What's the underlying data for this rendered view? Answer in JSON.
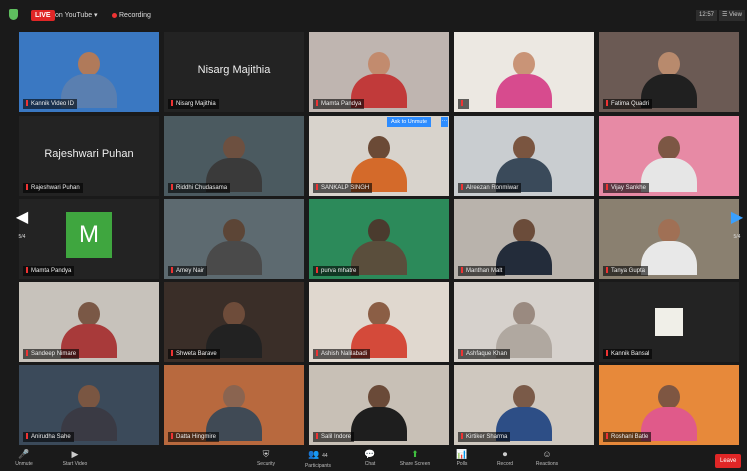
{
  "topbar": {
    "live_label": "LIVE",
    "youtube_label": "on YouTube ▾",
    "recording_label": "Recording",
    "clock": "12:57",
    "view_label": "☰ View"
  },
  "pager": {
    "left_label": "5/4",
    "right_label": "5/4"
  },
  "colors": {
    "active_speaker_border": "#d9d240",
    "live_red": "#e02626",
    "avatar_green": "#3fa63f",
    "ask_blue": "#2d8cff"
  },
  "tiles": [
    {
      "name": "Kannik Video ID",
      "head": "#b07a5a",
      "body": "#5a7fb0",
      "bg": "#3a78c2"
    },
    {
      "name": "Nisarg Majithia"
    },
    {
      "name": "Mamta Pandya",
      "head": "#c28b6e",
      "body": "#c13a3a",
      "bg": "#bfb5b0"
    },
    {
      "name": "",
      "head": "#c99477",
      "body": "#d74b8e",
      "bg": "#ece8e2"
    },
    {
      "name": "Fatima Quadri",
      "head": "#b88a6d",
      "body": "#202020",
      "bg": "#6b5a54"
    },
    {
      "name": "Rajeshwari Puhan"
    },
    {
      "name": "Riddhi Chudasama",
      "head": "#6d5040",
      "body": "#3a3a3a",
      "bg": "#4b5a60"
    },
    {
      "name": "SANKALP SINGH",
      "head": "#6b4a36",
      "body": "#d46a2a",
      "bg": "#d8d3cc"
    },
    {
      "name": "Alreezan Ronmiwar",
      "head": "#7a5540",
      "body": "#3a4a5a",
      "bg": "#c9cdd0"
    },
    {
      "name": "Vijay Sankhe",
      "head": "#7c5744",
      "body": "#e6e6e6",
      "bg": "#e78aa5"
    },
    {
      "name": "Mamta Pandya"
    },
    {
      "name": "Amey Nair",
      "head": "#5c4536",
      "body": "#4a4a4a",
      "bg": "#5d6a70"
    },
    {
      "name": "purva mhatre",
      "head": "#4a3b2e",
      "body": "#5a4e3c",
      "bg": "#2c8a5a"
    },
    {
      "name": "Manthan Malt",
      "head": "#6b4c3a",
      "body": "#232c3a",
      "bg": "#b9b3ac"
    },
    {
      "name": "Tanya Gupta",
      "head": "#a07055",
      "body": "#e8e8e8",
      "bg": "#8a8070"
    },
    {
      "name": "Sandeep Nimare",
      "head": "#7a5846",
      "body": "#a83a3a",
      "bg": "#c7c2bb"
    },
    {
      "name": "Shweta Barave",
      "head": "#6e4c3a",
      "body": "#222222",
      "bg": "#3a2e28"
    },
    {
      "name": "Ashish Nalilabadi",
      "head": "#8b5e45",
      "body": "#d44a3a",
      "bg": "#e0d8cf"
    },
    {
      "name": "Ashfaque Khan",
      "head": "#9a8a80",
      "body": "#b0a8a0",
      "bg": "#d6d1cc"
    },
    {
      "name": "Kannik Bansal"
    },
    {
      "name": "Anirudha Sahe",
      "head": "#7a5642",
      "body": "#3a3a44",
      "bg": "#3b4a5a"
    },
    {
      "name": "Datta Hingmire",
      "head": "#8a6450",
      "body": "#404a55",
      "bg": "#b8693e"
    },
    {
      "name": "Salil Indore",
      "head": "#6a4a38",
      "body": "#1e1e1e",
      "bg": "#c8c0b6"
    },
    {
      "name": "Kirtiker Sharma",
      "head": "#7a5a48",
      "body": "#2d4e86",
      "bg": "#cfc8bf"
    },
    {
      "name": "Roshani Batle",
      "head": "#7e5642",
      "body": "#e05a8a",
      "bg": "#e7893a"
    }
  ],
  "ask_unmute_label": "Ask to Unmute",
  "avatar_letter": "M",
  "toolbar": {
    "unmute": "Unmute",
    "start_video": "Start Video",
    "security": "Security",
    "participants": "Participants",
    "participants_count": "44",
    "chat": "Chat",
    "share_screen": "Share Screen",
    "polls": "Polls",
    "record": "Record",
    "reactions": "Reactions",
    "leave": "Leave"
  }
}
